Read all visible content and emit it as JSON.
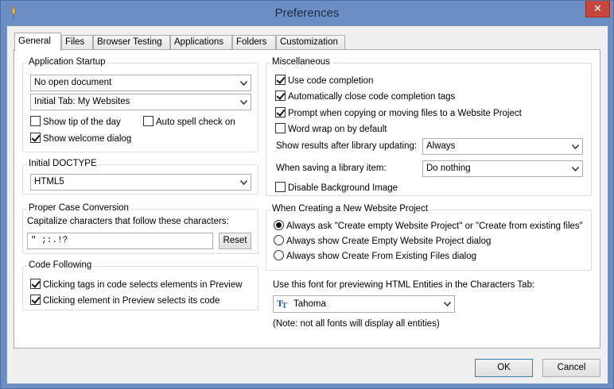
{
  "window": {
    "title": "Preferences",
    "close_glyph": "✕"
  },
  "tabs": [
    {
      "label": "General",
      "active": true
    },
    {
      "label": "Files"
    },
    {
      "label": "Browser Testing"
    },
    {
      "label": "Applications"
    },
    {
      "label": "Folders"
    },
    {
      "label": "Customization"
    }
  ],
  "app_startup": {
    "legend": "Application Startup",
    "open_document": "No open document",
    "initial_tab": "Initial Tab: My Websites",
    "show_tip": {
      "label": "Show tip of the day",
      "checked": false
    },
    "auto_spell": {
      "label": "Auto spell check on",
      "checked": false
    },
    "show_welcome": {
      "label": "Show welcome dialog",
      "checked": true
    }
  },
  "doctype": {
    "legend": "Initial DOCTYPE",
    "value": "HTML5"
  },
  "case_conversion": {
    "legend": "Proper Case Conversion",
    "description": "Capitalize characters that follow these characters:",
    "value": "\" ;:.!?",
    "reset_label": "Reset"
  },
  "code_following": {
    "legend": "Code Following",
    "tags_select": {
      "label": "Clicking tags in code selects elements in Preview",
      "checked": true
    },
    "element_select": {
      "label": "Clicking element in Preview selects its code",
      "checked": true
    }
  },
  "misc": {
    "legend": "Miscellaneous",
    "code_completion": {
      "label": "Use code completion",
      "checked": true
    },
    "auto_close": {
      "label": "Automatically close code completion tags",
      "checked": true
    },
    "prompt_copy": {
      "label": "Prompt when copying or moving files to a Website Project",
      "checked": true
    },
    "word_wrap": {
      "label": "Word wrap on by default",
      "checked": false
    },
    "show_results_label": "Show results after library updating:",
    "show_results_value": "Always",
    "saving_label": "When saving a library item:",
    "saving_value": "Do nothing",
    "disable_bg": {
      "label": "Disable Background Image",
      "checked": false
    }
  },
  "new_project": {
    "legend": "When Creating a New Website Project",
    "options": [
      {
        "label": "Always ask \"Create empty Website Project\" or \"Create from existing files\"",
        "selected": true
      },
      {
        "label": "Always show Create Empty Website Project dialog",
        "selected": false
      },
      {
        "label": "Always show Create From Existing Files dialog",
        "selected": false
      }
    ]
  },
  "entities_font": {
    "label": "Use this font for previewing HTML Entities in the Characters Tab:",
    "value": "Tahoma",
    "note": "(Note: not all fonts will display all entities)"
  },
  "footer": {
    "ok_label": "OK",
    "cancel_label": "Cancel"
  },
  "colors": {
    "window_frame": "#6b8fc5",
    "close_button": "#c7463c",
    "default_button_border": "#3c7fb1"
  }
}
